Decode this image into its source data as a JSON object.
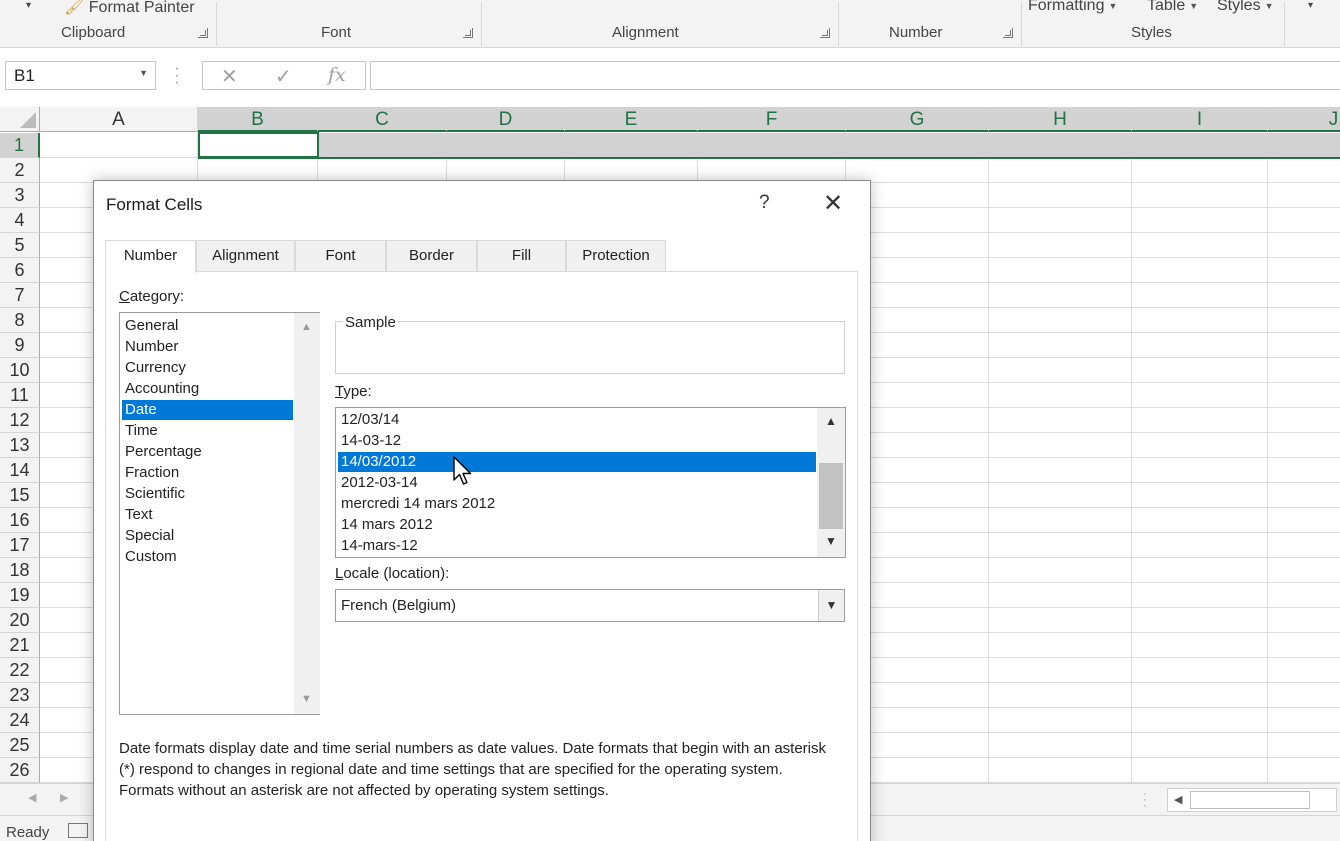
{
  "ribbon": {
    "format_painter": "Format Painter",
    "conditional_formatting": "Formatting",
    "format_as_table": "Table",
    "cell_styles": "Styles",
    "groups": {
      "clipboard": "Clipboard",
      "font": "Font",
      "alignment": "Alignment",
      "number": "Number",
      "styles": "Styles"
    }
  },
  "formula_bar": {
    "name_box": "B1",
    "cancel_icon": "✕",
    "enter_icon": "✓",
    "function_icon": "fx",
    "formula": ""
  },
  "grid": {
    "columns": [
      "A",
      "B",
      "C",
      "D",
      "E",
      "F",
      "G",
      "H",
      "I",
      "J"
    ],
    "rows": [
      "1",
      "2",
      "3",
      "4",
      "5",
      "6",
      "7",
      "8",
      "9",
      "10",
      "11",
      "12",
      "13",
      "14",
      "15",
      "16",
      "17",
      "18",
      "19",
      "20",
      "21",
      "22",
      "23",
      "24",
      "25",
      "26"
    ],
    "selected_cell": "B1"
  },
  "status": {
    "ready": "Ready"
  },
  "dialog": {
    "title": "Format Cells",
    "help": "?",
    "close": "✕",
    "tabs": [
      "Number",
      "Alignment",
      "Font",
      "Border",
      "Fill",
      "Protection"
    ],
    "active_tab": "Number",
    "category_label": "Category:",
    "categories": [
      "General",
      "Number",
      "Currency",
      "Accounting",
      "Date",
      "Time",
      "Percentage",
      "Fraction",
      "Scientific",
      "Text",
      "Special",
      "Custom"
    ],
    "selected_category": "Date",
    "sample_label": "Sample",
    "sample_value": "",
    "type_label": "Type:",
    "types": [
      "12/03/14",
      "14-03-12",
      "14/03/2012",
      "2012-03-14",
      "mercredi 14 mars 2012",
      "14 mars 2012",
      "14-mars-12"
    ],
    "selected_type": "14/03/2012",
    "locale_label": "Locale (location):",
    "locale_value": "French (Belgium)",
    "description": "Date formats display date and time serial numbers as date values.  Date formats that begin with an asterisk (*) respond to changes in regional date and time settings that are specified for the operating system. Formats without an asterisk are not affected by operating system settings."
  },
  "colors": {
    "selection_blue": "#0078d7",
    "excel_green": "#217346",
    "header_gray": "#f3f3f3"
  }
}
